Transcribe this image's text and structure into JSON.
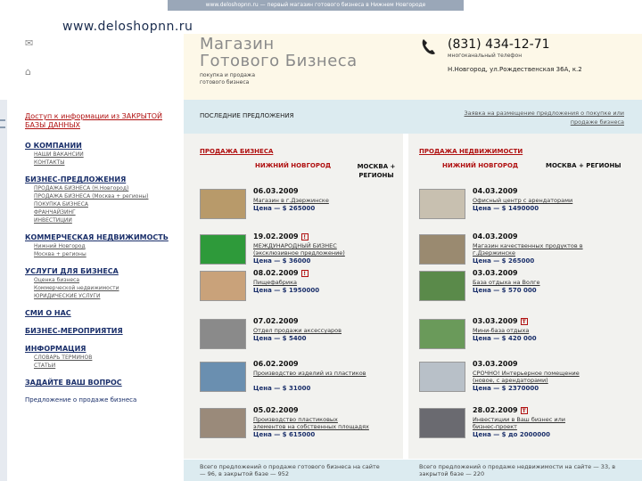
{
  "top_strip": "www.deloshopnn.ru — первый магазин готового бизнеса в Нижнем Новгороде",
  "url": "www.deloshopnn.ru",
  "header": {
    "logo_line1": "Магазин",
    "logo_line2": "Готового Бизнеса",
    "logo_sub": "покупка и продажа готового бизнеса",
    "phone": "(831) 434-12-71",
    "phone_sub": "многоканальный телефон",
    "address": "Н.Новгород, ул.Рождественская 36А, к.2"
  },
  "sidebar": {
    "access": "Доступ к информации из ЗАКРЫТОЙ БАЗЫ ДАННЫХ",
    "sections": [
      {
        "title": "О КОМПАНИИ",
        "items": [
          "НАШИ ВАКАНСИИ",
          "КОНТАКТЫ"
        ]
      },
      {
        "title": "БИЗНЕС-ПРЕДЛОЖЕНИЯ",
        "items": [
          "ПРОДАЖА БИЗНЕСА (Н.Новгород)",
          "ПРОДАЖА БИЗНЕСА (Москва + регионы)",
          "ПОКУПКА БИЗНЕСА",
          "ФРАНЧАЙЗИНГ",
          "ИНВЕСТИЦИИ"
        ]
      },
      {
        "title": "КОММЕРЧЕСКАЯ НЕДВИЖИМОСТЬ",
        "items": [
          "Нижний Новгород",
          "Москва + регионы"
        ]
      },
      {
        "title": "УСЛУГИ ДЛЯ БИЗНЕСА",
        "items": [
          "Оценка бизнеса",
          "Коммерческой недвижимости",
          "ЮРИДИЧЕСКИЕ УСЛУГИ"
        ]
      },
      {
        "title": "СМИ О НАС",
        "items": []
      },
      {
        "title": "БИЗНЕС-МЕРОПРИЯТИЯ",
        "items": []
      },
      {
        "title": "ИНФОРМАЦИЯ",
        "items": [
          "СЛОВАРЬ ТЕРМИНОВ",
          "СТАТЬИ"
        ]
      },
      {
        "title": "ЗАДАЙТЕ ВАШ ВОПРОС",
        "items": []
      }
    ],
    "final_link": "Предложение о продаже бизнеса"
  },
  "left_col": {
    "header": "ПОСЛЕДНИЕ ПРЕДЛОЖЕНИЯ",
    "section_title": "ПРОДАЖА БИЗНЕСА",
    "tab_active": "НИЖНИЙ НОВГОРОД",
    "tab_other": "МОСКВА + РЕГИОНЫ",
    "items": [
      {
        "date": "06.03.2009",
        "badge": "",
        "title": "Магазин в г.Дзержинске",
        "price": "Цена — $ 265000"
      },
      {
        "date": "19.02.2009",
        "badge": "!",
        "title": "МЕЖДУНАРОДНЫЙ БИЗНЕС (эксклюзивное предложение)",
        "price": "Цена — $ 36000"
      },
      {
        "date": "08.02.2009",
        "badge": "!",
        "title": "Пищефабрика",
        "price": "Цена — $ 1950000"
      },
      {
        "date": "07.02.2009",
        "badge": "",
        "title": "Отдел продажи аксессуаров",
        "price": "Цена — $ 5400"
      },
      {
        "date": "06.02.2009",
        "badge": "",
        "title": "Производство изделий из пластиков",
        "price": "Цена — $ 31000"
      },
      {
        "date": "05.02.2009",
        "badge": "",
        "title": "Производство пластиковых элементов на собственных площадях",
        "price": "Цена — $ 615000"
      }
    ],
    "footer": "Всего предложений о продаже готового бизнеса на сайте — 96, в закрытой базе — 952"
  },
  "right_col": {
    "header_link": "Заявка на размещение предложения о покупке или продаже бизнеса",
    "section_title": "ПРОДАЖА НЕДВИЖИМОСТИ",
    "tab_active": "НИЖНИЙ НОВГОРОД",
    "tab_other": "МОСКВА + РЕГИОНЫ",
    "items": [
      {
        "date": "04.03.2009",
        "badge": "",
        "title": "Офисный центр с арендаторами",
        "price": "Цена — $ 1490000"
      },
      {
        "date": "04.03.2009",
        "badge": "",
        "title": "Магазин качественных продуктов в г.Дзержинске",
        "price": "Цена — $ 265000"
      },
      {
        "date": "03.03.2009",
        "badge": "",
        "title": "База отдыха на Волге",
        "price": "Цена — $ 570 000"
      },
      {
        "date": "03.03.2009",
        "badge": "T",
        "title": "Мини-база отдыха",
        "price": "Цена — $ 420 000"
      },
      {
        "date": "03.03.2009",
        "badge": "",
        "title": "СРОЧНО! Интерьерное помещение (новое, с арендаторами)",
        "price": "Цена — $ 2370000"
      },
      {
        "date": "28.02.2009",
        "badge": "T",
        "title": "Инвестиции в Ваш бизнес или бизнес-проект",
        "price": "Цена — $ до 2000000"
      }
    ],
    "footer": "Всего предложений о продаже недвижимости на сайте — 33, в закрытой базе — 220"
  },
  "colors": {
    "accent_red": "#b01010",
    "nav_blue": "#1a2f6a",
    "panel_blue": "#dcebf0",
    "list_grey": "#f2f2ef"
  }
}
